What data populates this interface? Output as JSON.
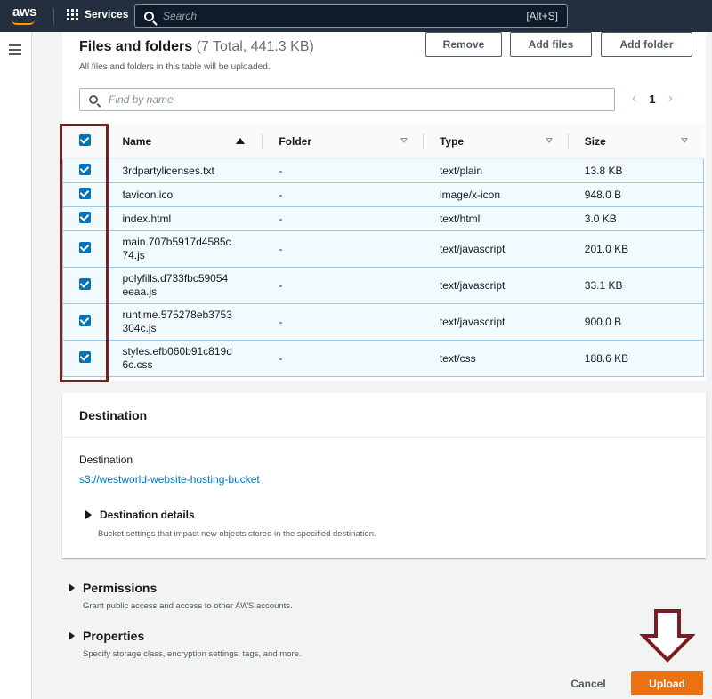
{
  "topnav": {
    "logo": "aws",
    "services_label": "Services",
    "search_placeholder": "Search",
    "search_shortcut": "[Alt+S]"
  },
  "files_panel": {
    "title": "Files and folders",
    "count": "(7 Total, 441.3 KB)",
    "description": "All files and folders in this table will be uploaded.",
    "buttons": {
      "remove": "Remove",
      "add_files": "Add files",
      "add_folder": "Add folder"
    },
    "find_placeholder": "Find by name",
    "pagination": {
      "current_page": "1"
    },
    "columns": [
      "Name",
      "Folder",
      "Type",
      "Size"
    ],
    "rows": [
      {
        "name": "3rdpartylicenses.txt",
        "folder": "-",
        "type": "text/plain",
        "size": "13.8 KB",
        "selected": true
      },
      {
        "name": "favicon.ico",
        "folder": "-",
        "type": "image/x-icon",
        "size": "948.0 B",
        "selected": true
      },
      {
        "name": "index.html",
        "folder": "-",
        "type": "text/html",
        "size": "3.0 KB",
        "selected": true
      },
      {
        "name_line1": "main.707b5917d4585c",
        "name_line2": "74.js",
        "folder": "-",
        "type": "text/javascript",
        "size": "201.0 KB",
        "selected": true
      },
      {
        "name_line1": "polyfills.d733fbc59054",
        "name_line2": "eeaa.js",
        "folder": "-",
        "type": "text/javascript",
        "size": "33.1 KB",
        "selected": true
      },
      {
        "name_line1": "runtime.575278eb3753",
        "name_line2": "304c.js",
        "folder": "-",
        "type": "text/javascript",
        "size": "900.0 B",
        "selected": true
      },
      {
        "name_line1": "styles.efb060b91c819d",
        "name_line2": "6c.css",
        "folder": "-",
        "type": "text/css",
        "size": "188.6 KB",
        "selected": true
      }
    ]
  },
  "destination": {
    "heading": "Destination",
    "label": "Destination",
    "link": "s3://westworld-website-hosting-bucket",
    "details_label": "Destination details",
    "details_desc": "Bucket settings that impact new objects stored in the specified destination."
  },
  "permissions": {
    "label": "Permissions",
    "desc": "Grant public access and access to other AWS accounts."
  },
  "properties": {
    "label": "Properties",
    "desc": "Specify storage class, encryption settings, tags, and more."
  },
  "footer": {
    "cancel": "Cancel",
    "upload": "Upload"
  },
  "colors": {
    "nav_bg": "#232f3e",
    "accent_orange": "#ec7211",
    "link_blue": "#0073bb",
    "annotation_red": "#7b1c24"
  }
}
